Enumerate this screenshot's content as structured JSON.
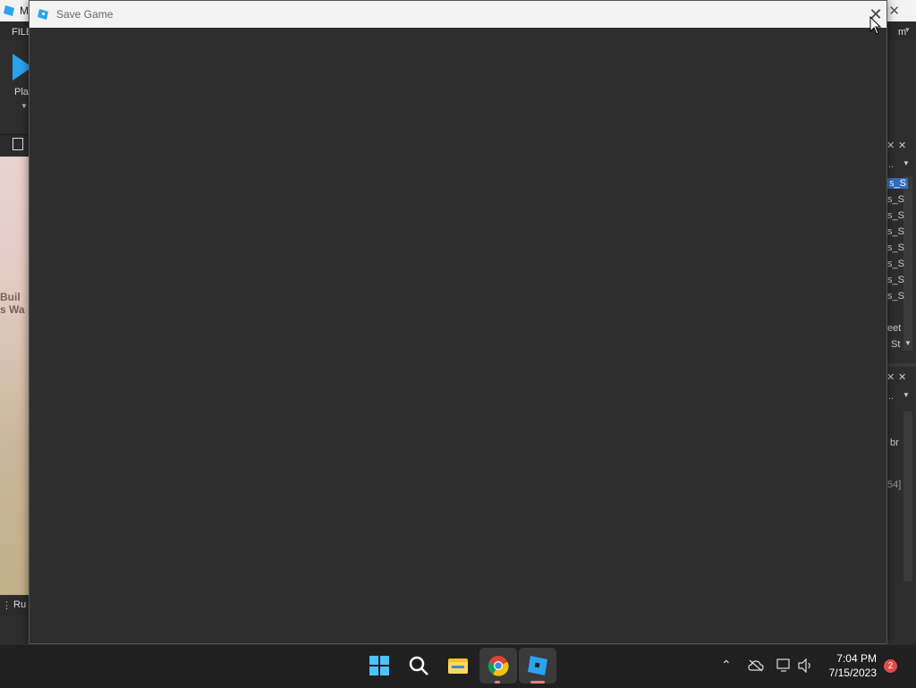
{
  "studio": {
    "title_fragment": "M",
    "menu_file": "FILE",
    "menu_right_fragment": "m",
    "play_label": "Pla",
    "viewport_text_1": "Buil",
    "viewport_text_2": "s Wa",
    "status_fragment": "Ru",
    "right_panel": {
      "items": [
        "s_S",
        "s_S",
        "s_S",
        "s_S",
        "s_S",
        "s_S",
        "s_S",
        "s_S"
      ],
      "eet": "eet",
      "st": "St",
      "dots1": "..",
      "dots2": "..",
      "br": "br",
      "value": "54]"
    }
  },
  "dialog": {
    "title": "Save Game",
    "close_glyph": "✕"
  },
  "taskbar": {
    "icons": [
      "windows-start-icon",
      "search-icon",
      "file-explorer-icon",
      "chrome-icon",
      "roblox-studio-icon"
    ],
    "time": "7:04 PM",
    "date": "7/15/2023",
    "notification_count": "2"
  },
  "colors": {
    "accent": "#2aa3f0",
    "dialog_bg": "#2e2e2e",
    "titlebar_bg": "#f3f3f3",
    "taskbar_bg": "#202020",
    "badge": "#e24a4a"
  }
}
